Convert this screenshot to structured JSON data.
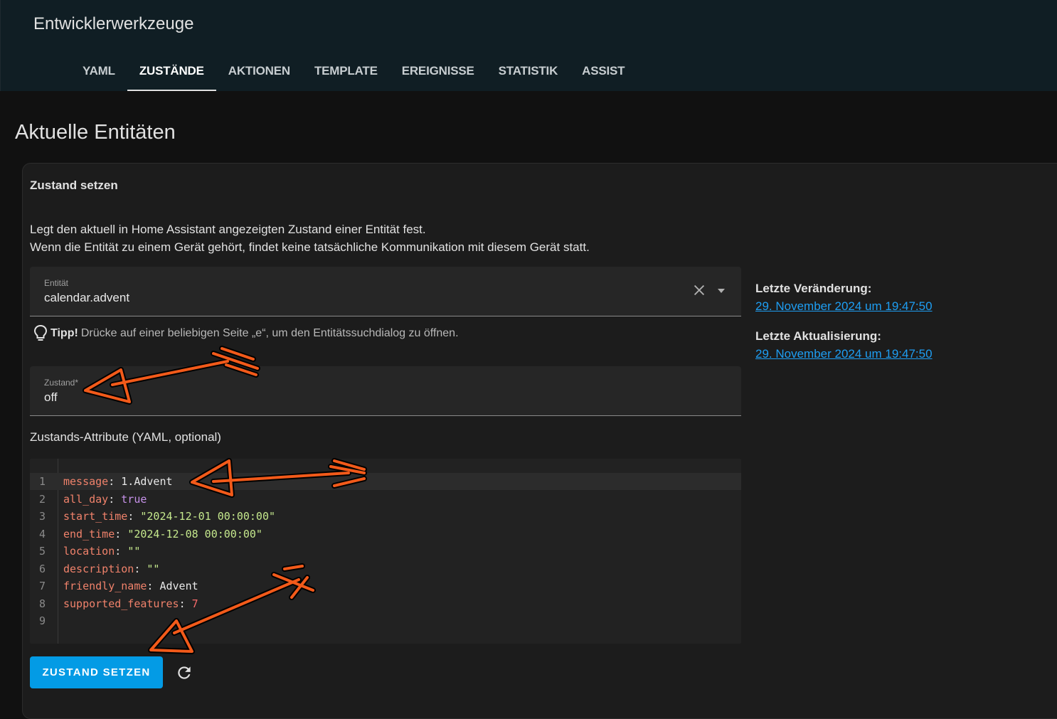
{
  "header": {
    "title": "Entwicklerwerkzeuge",
    "tabs": [
      {
        "label": "YAML"
      },
      {
        "label": "ZUSTÄNDE"
      },
      {
        "label": "AKTIONEN"
      },
      {
        "label": "TEMPLATE"
      },
      {
        "label": "EREIGNISSE"
      },
      {
        "label": "STATISTIK"
      },
      {
        "label": "ASSIST"
      }
    ],
    "active_tab": "ZUSTÄNDE"
  },
  "page": {
    "title": "Aktuelle Entitäten"
  },
  "card": {
    "title": "Zustand setzen",
    "description_line1": "Legt den aktuell in Home Assistant angezeigten Zustand einer Entität fest.",
    "description_line2": "Wenn die Entität zu einem Gerät gehört, findet keine tatsächliche Kommunikation mit diesem Gerät statt.",
    "entity_field": {
      "label": "Entität",
      "value": "calendar.advent"
    },
    "tip": {
      "strong": "Tipp!",
      "text": "Drücke auf einer beliebigen Seite „e“, um den Entitätssuchdialog zu öffnen."
    },
    "state_field": {
      "label": "Zustand*",
      "value": "off"
    },
    "attributes_label": "Zustands-Attribute (YAML, optional)",
    "yaml_lines": [
      {
        "num": "1",
        "key": "message",
        "value": "1.Advent",
        "type": "plain"
      },
      {
        "num": "2",
        "key": "all_day",
        "value": "true",
        "type": "bool"
      },
      {
        "num": "3",
        "key": "start_time",
        "value": "\"2024-12-01 00:00:00\"",
        "type": "string"
      },
      {
        "num": "4",
        "key": "end_time",
        "value": "\"2024-12-08 00:00:00\"",
        "type": "string"
      },
      {
        "num": "5",
        "key": "location",
        "value": "\"\"",
        "type": "string"
      },
      {
        "num": "6",
        "key": "description",
        "value": "\"\"",
        "type": "string"
      },
      {
        "num": "7",
        "key": "friendly_name",
        "value": "Advent",
        "type": "plain"
      },
      {
        "num": "8",
        "key": "supported_features",
        "value": "7",
        "type": "number"
      },
      {
        "num": "9",
        "key": "",
        "value": "",
        "type": "empty"
      }
    ],
    "submit_label": "ZUSTAND SETZEN"
  },
  "sidebar": {
    "last_changed_label": "Letzte Veränderung:",
    "last_changed_value": "29. November 2024 um 19:47:50",
    "last_updated_label": "Letzte Aktualisierung:",
    "last_updated_value": "29. November 2024 um 19:47:50"
  },
  "colors": {
    "accent": "#039be5",
    "link": "#1e9ef3",
    "annotation_arrow": "#f25a1a"
  },
  "icons": [
    "close-icon",
    "chevron-down-icon",
    "lightbulb-icon",
    "refresh-icon"
  ]
}
